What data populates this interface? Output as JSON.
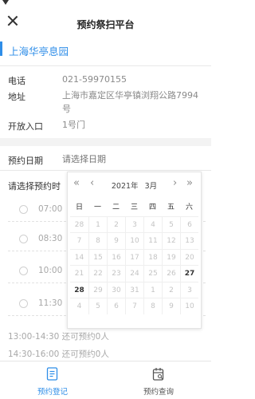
{
  "nav": {
    "title": "预约祭扫平台"
  },
  "park": {
    "name": "上海华亭息园"
  },
  "info": {
    "phone_label": "电话",
    "phone": "021-59970155",
    "address_label": "地址",
    "address": "上海市嘉定区华亭镇浏翔公路7994号",
    "entrance_label": "开放入口",
    "entrance": "1号门"
  },
  "booking": {
    "date_label": "预约日期",
    "date_placeholder": "请选择日期",
    "time_label": "请选择预约时",
    "slots": [
      {
        "time": "07:00"
      },
      {
        "time": "08:30"
      },
      {
        "time": "10:00"
      },
      {
        "time": "11:30"
      }
    ],
    "full_slots": [
      {
        "text": "13:00-14:30   还可预约0人"
      },
      {
        "text": "14:30-16:00   还可预约0人"
      }
    ]
  },
  "calendar": {
    "year": "2021年",
    "month": "3月",
    "nav": {
      "prev_year": "«",
      "prev_month": "‹",
      "next_month": "›",
      "next_year": "»"
    },
    "weekdays": [
      "日",
      "一",
      "二",
      "三",
      "四",
      "五",
      "六"
    ],
    "weeks": [
      [
        {
          "d": "28",
          "on": false
        },
        {
          "d": "1",
          "on": false
        },
        {
          "d": "2",
          "on": false
        },
        {
          "d": "3",
          "on": false
        },
        {
          "d": "4",
          "on": false
        },
        {
          "d": "5",
          "on": false
        },
        {
          "d": "6",
          "on": false
        }
      ],
      [
        {
          "d": "7",
          "on": false
        },
        {
          "d": "8",
          "on": false
        },
        {
          "d": "9",
          "on": false
        },
        {
          "d": "10",
          "on": false
        },
        {
          "d": "11",
          "on": false
        },
        {
          "d": "12",
          "on": false
        },
        {
          "d": "13",
          "on": false
        }
      ],
      [
        {
          "d": "14",
          "on": false
        },
        {
          "d": "15",
          "on": false
        },
        {
          "d": "16",
          "on": false
        },
        {
          "d": "17",
          "on": false
        },
        {
          "d": "18",
          "on": false
        },
        {
          "d": "19",
          "on": false
        },
        {
          "d": "20",
          "on": false
        }
      ],
      [
        {
          "d": "21",
          "on": false
        },
        {
          "d": "22",
          "on": false
        },
        {
          "d": "23",
          "on": false
        },
        {
          "d": "24",
          "on": false
        },
        {
          "d": "25",
          "on": false
        },
        {
          "d": "26",
          "on": false
        },
        {
          "d": "27",
          "on": true
        }
      ],
      [
        {
          "d": "28",
          "on": true
        },
        {
          "d": "29",
          "on": false
        },
        {
          "d": "30",
          "on": false
        },
        {
          "d": "31",
          "on": false
        },
        {
          "d": "1",
          "on": false
        },
        {
          "d": "2",
          "on": false
        },
        {
          "d": "3",
          "on": false
        }
      ],
      [
        {
          "d": "4",
          "on": false
        },
        {
          "d": "5",
          "on": false
        },
        {
          "d": "6",
          "on": false
        },
        {
          "d": "7",
          "on": false
        },
        {
          "d": "8",
          "on": false
        },
        {
          "d": "9",
          "on": false
        },
        {
          "d": "10",
          "on": false
        }
      ]
    ]
  },
  "tabs": [
    {
      "label": "预约登记",
      "icon": "register-icon",
      "active": true
    },
    {
      "label": "预约查询",
      "icon": "calendar-query-icon",
      "active": false
    }
  ],
  "colors": {
    "accent": "#2f8ee8",
    "muted": "#9b9b9b"
  }
}
